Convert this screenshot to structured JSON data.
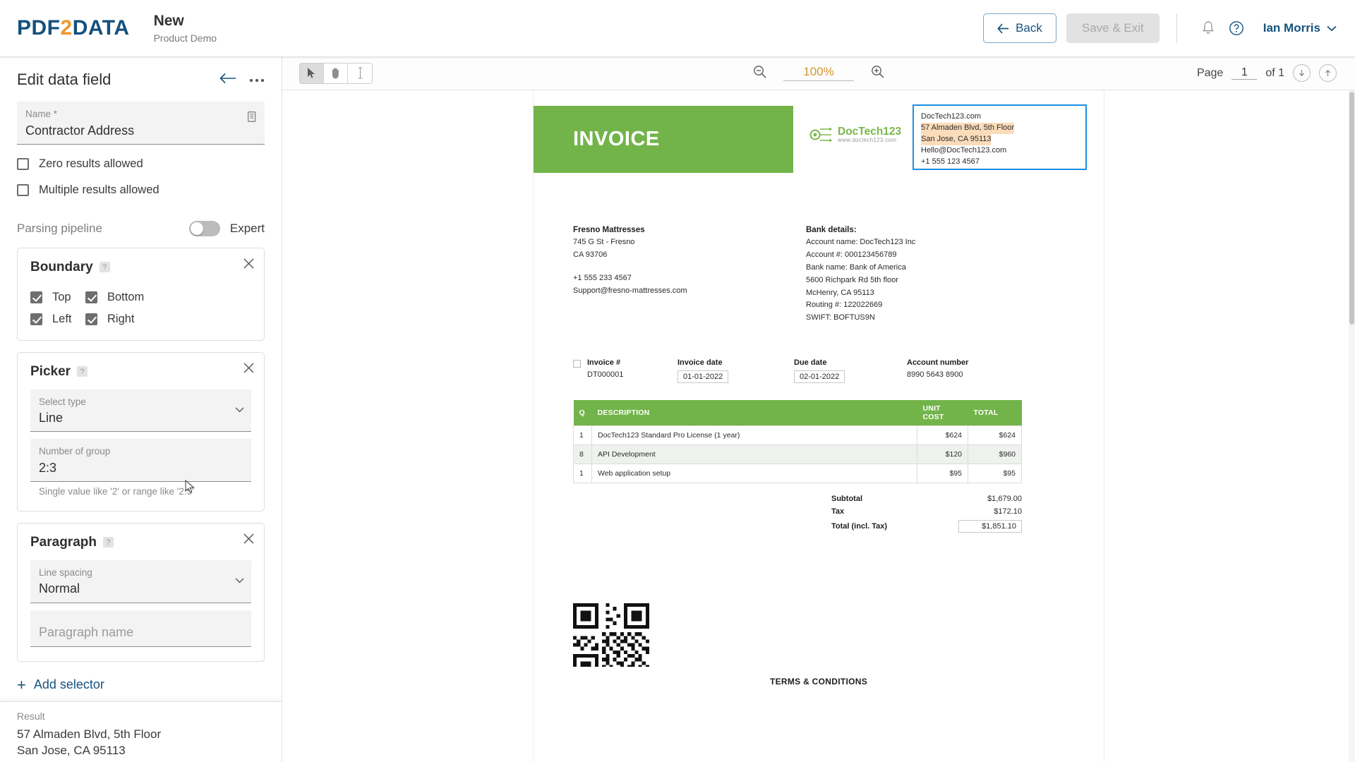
{
  "topbar": {
    "logo": {
      "part1": "PDF",
      "part2": "2",
      "part3": "DATA"
    },
    "doc_title": "New",
    "doc_subtitle": "Product Demo",
    "back_label": "Back",
    "save_label": "Save & Exit",
    "notifications_icon": "bell-icon",
    "help_icon": "help-circle-icon",
    "user_name": "Ian Morris"
  },
  "left_panel": {
    "title": "Edit data field",
    "back_icon": "arrow-left-icon",
    "more_icon": "more-horizontal-icon",
    "name_field": {
      "label": "Name *",
      "value": "Contractor Address",
      "trailing_icon": "copy-icon"
    },
    "checkboxes": [
      {
        "label": "Zero results allowed",
        "checked": false
      },
      {
        "label": "Multiple results allowed",
        "checked": false
      }
    ],
    "pipeline": {
      "label": "Parsing pipeline",
      "toggle_label": "Expert",
      "toggle_on": false
    },
    "boundary": {
      "title": "Boundary",
      "help": "?",
      "options": [
        {
          "label": "Top",
          "checked": true
        },
        {
          "label": "Bottom",
          "checked": true
        },
        {
          "label": "Left",
          "checked": true
        },
        {
          "label": "Right",
          "checked": true
        }
      ]
    },
    "picker": {
      "title": "Picker",
      "help": "?",
      "type_label": "Select type",
      "type_value": "Line",
      "group_label": "Number of group",
      "group_value": "2:3",
      "group_hint": "Single value like '2' or range like '2:5'"
    },
    "paragraph": {
      "title": "Paragraph",
      "help": "?",
      "spacing_label": "Line spacing",
      "spacing_value": "Normal",
      "name_placeholder": "Paragraph name",
      "name_value": ""
    },
    "add_selector": "Add selector",
    "result": {
      "label": "Result",
      "value": "57 Almaden Blvd, 5th Floor\nSan Jose, CA 95113"
    }
  },
  "viewer": {
    "tools": [
      {
        "name": "select-tool",
        "icon": "cursor-icon",
        "active": true
      },
      {
        "name": "pan-tool",
        "icon": "hand-icon",
        "active": false
      },
      {
        "name": "text-tool",
        "icon": "text-cursor-icon",
        "active": false
      }
    ],
    "zoom_out_icon": "zoom-out-icon",
    "zoom_in_icon": "zoom-in-icon",
    "zoom_level": "100%",
    "page_label": "Page",
    "page_number": "1",
    "page_of": "of 1",
    "prev_icon": "arrow-down-circle-icon",
    "next_icon": "arrow-up-circle-icon"
  },
  "invoice": {
    "heading": "INVOICE",
    "logo_name": "DocTech123",
    "logo_url": "www.doctech123.com",
    "selection": {
      "lines": [
        {
          "text": "DocTech123.com",
          "highlight": false
        },
        {
          "text": "57 Almaden Blvd, 5th Floor",
          "highlight": true
        },
        {
          "text": "San Jose, CA 95113",
          "highlight": true
        },
        {
          "text": "Hello@DocTech123.com",
          "highlight": false
        },
        {
          "text": "+1 555 123 4567",
          "highlight": false
        }
      ]
    },
    "bill_to": {
      "name": "Fresno Mattresses",
      "lines": [
        "745 G St - Fresno",
        "CA 93706"
      ],
      "phone": "+1 555 233 4567",
      "email": "Support@fresno-mattresses.com"
    },
    "bank": {
      "title": "Bank details:",
      "lines": [
        "Account name: DocTech123 Inc",
        "Account #: 000123456789",
        "Bank name: Bank of America",
        "5600 Richpark Rd 5th floor",
        "McHenry, CA 95113",
        "Routing #: 122022669",
        "SWIFT: BOFTUS9N"
      ]
    },
    "meta": [
      {
        "label": "Invoice #",
        "value": "DT000001",
        "boxed": false
      },
      {
        "label": "Invoice date",
        "value": "01-01-2022",
        "boxed": true
      },
      {
        "label": "Due date",
        "value": "02-01-2022",
        "boxed": true
      },
      {
        "label": "Account number",
        "value": "8990 5643 8900",
        "boxed": false
      }
    ],
    "table": {
      "headers": [
        "Q",
        "DESCRIPTION",
        "UNIT COST",
        "TOTAL"
      ],
      "rows": [
        {
          "q": "1",
          "desc": "DocTech123 Standard Pro License (1 year)",
          "unit": "$624",
          "total": "$624"
        },
        {
          "q": "8",
          "desc": "API Development",
          "unit": "$120",
          "total": "$960"
        },
        {
          "q": "1",
          "desc": "Web application setup",
          "unit": "$95",
          "total": "$95"
        }
      ]
    },
    "totals": [
      {
        "label": "Subtotal",
        "value": "$1,679.00",
        "boxed": false
      },
      {
        "label": "Tax",
        "value": "$172.10",
        "boxed": false
      },
      {
        "label": "Total (incl. Tax)",
        "value": "$1,851.10",
        "boxed": true
      }
    ],
    "terms": "TERMS & CONDITIONS"
  },
  "colors": {
    "brand_blue": "#14507e",
    "brand_orange": "#f0982d",
    "invoice_green": "#72b44a",
    "selection_blue": "#1a8fe3",
    "highlight_orange": "#fbdcba"
  }
}
